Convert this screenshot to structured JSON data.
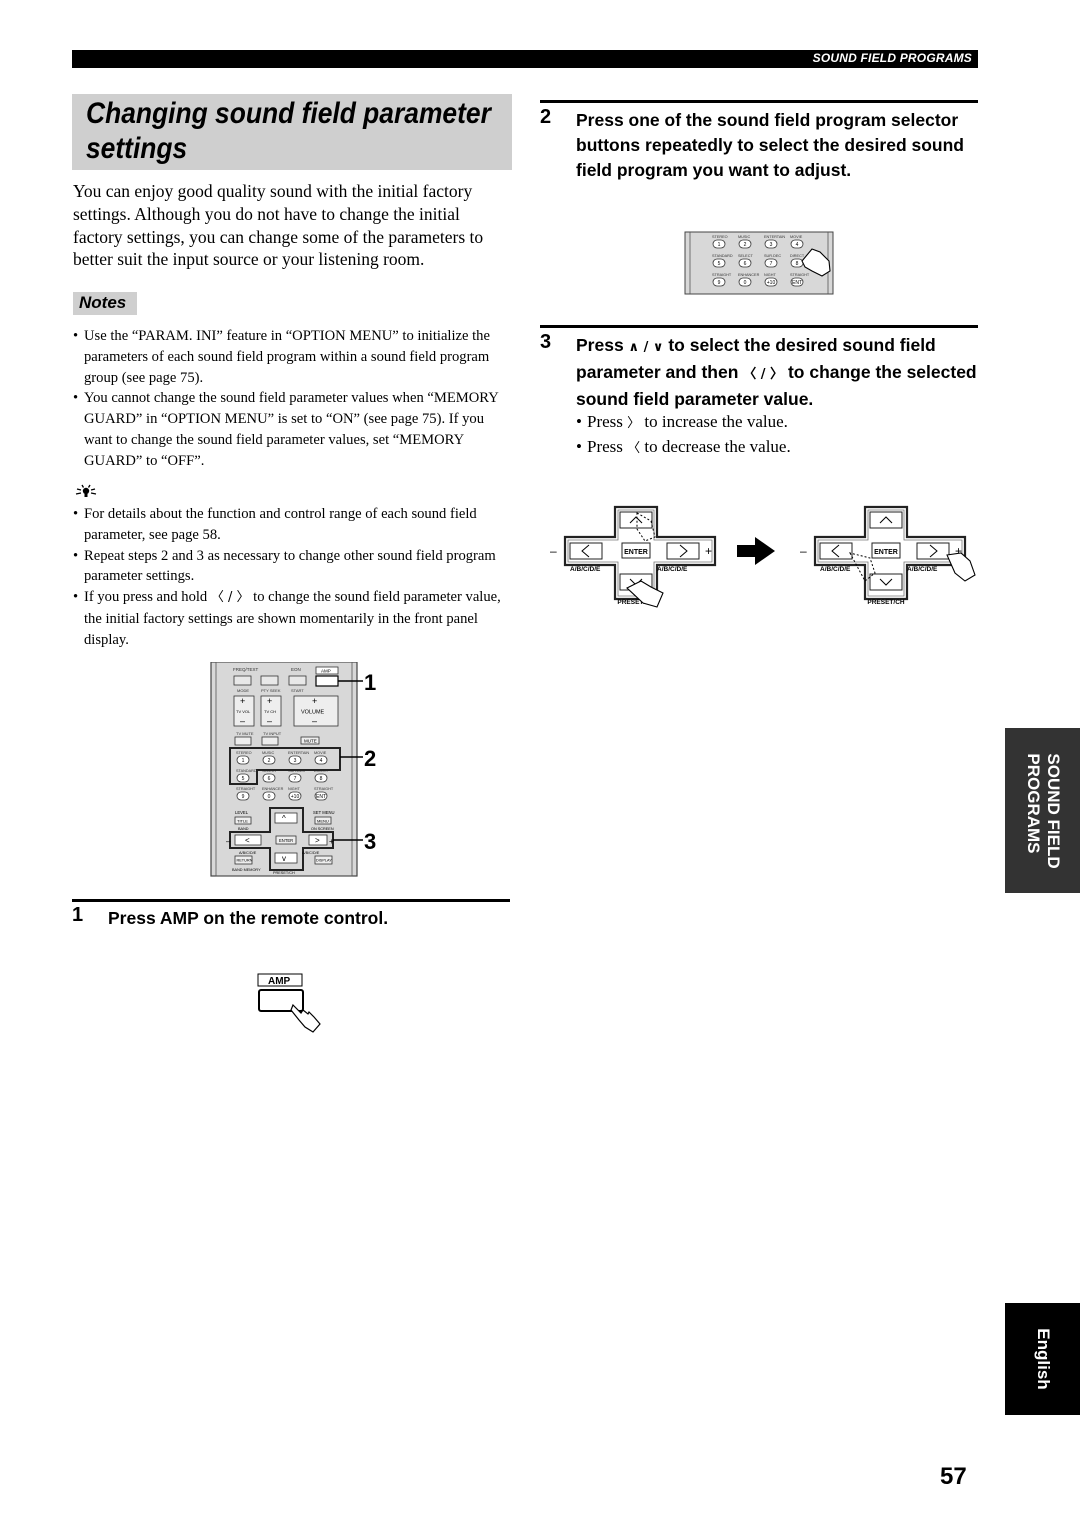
{
  "header": {
    "section_label": "SOUND FIELD PROGRAMS"
  },
  "title": {
    "line1": "Changing sound field parameter",
    "line2": "settings"
  },
  "intro": "You can enjoy good quality sound with the initial factory settings. Although you do not have to change the initial factory settings, you can change some of the parameters to better suit the input source or your listening room.",
  "notes": {
    "heading": "Notes",
    "items": [
      "Use the “PARAM. INI” feature in “OPTION MENU” to initialize the parameters of each sound field program within a sound field program group (see page 75).",
      "You cannot change the sound field parameter values when “MEMORY GUARD” in “OPTION MENU” is set to “ON” (see page 75). If you want to change the sound field parameter values, set “MEMORY GUARD” to “OFF”."
    ]
  },
  "tips": {
    "icon": "lightbulb-tip-icon",
    "items": [
      "For details about the function and control range of each sound field parameter, see page 58.",
      "Repeat steps 2 and 3 as necessary to change other sound field program parameter settings.",
      {
        "before": "If you press and hold ",
        "glyphs": "〈 / 〉",
        "after": " to change the sound field parameter value, the initial factory settings are shown momentarily in the front panel display."
      }
    ]
  },
  "remote": {
    "callouts": [
      "1",
      "2",
      "3"
    ],
    "top_labels": [
      "FREQ/TEXT",
      "EON",
      "AMP"
    ],
    "sub_labels": [
      "MODE",
      "PTY SEEK",
      "START"
    ],
    "vol_labels": [
      "TV VOL",
      "TV CH",
      "VOLUME"
    ],
    "mute_labels": [
      "TV MUTE",
      "TV INPUT",
      "MUTE"
    ],
    "program_rows": [
      {
        "labels": [
          "STEREO",
          "MUSIC",
          "ENTERTAIN",
          "MOVIE"
        ],
        "keys": [
          "1",
          "2",
          "3",
          "4"
        ]
      },
      {
        "labels": [
          "STANDARD",
          "SELECT",
          "SUR.DEC",
          "DIRECT"
        ],
        "keys": [
          "5",
          "6",
          "7",
          "8"
        ]
      },
      {
        "labels": [
          "STRAIGHT",
          "ENHANCER",
          "NIGHT",
          "STRAIGHT"
        ],
        "keys": [
          "9",
          "0",
          "+10",
          "ENT"
        ]
      }
    ],
    "nav_labels": {
      "level": "LEVEL",
      "title": "TITLE",
      "band": "BAND",
      "set_menu": "SET MENU",
      "menu": "MENU",
      "on_screen": "ON SCREEN",
      "enter": "ENTER",
      "abcde": "A/B/C/D/E",
      "return": "RETURN",
      "display": "DISPLAY",
      "memory": "BAND MEMORY",
      "preset": "PRESET/CH",
      "minus": "–",
      "plus": "+"
    }
  },
  "steps": [
    {
      "number": "1",
      "text": "Press AMP on the remote control.",
      "illustration_label": "AMP"
    },
    {
      "number": "2",
      "text": "Press one of the sound field program selector buttons repeatedly to select the desired sound field program you want to adjust."
    },
    {
      "number": "3",
      "text_parts": [
        "Press ",
        "∧ / ∨",
        " to select the desired sound field parameter and then ",
        "〈 / 〉",
        " to change the selected sound field parameter value."
      ],
      "bullets": [
        {
          "before": "Press ",
          "glyph": "〉",
          "after": " to increase the value."
        },
        {
          "before": "Press ",
          "glyph": "〈",
          "after": " to decrease the value."
        }
      ],
      "pad_labels": {
        "enter": "ENTER",
        "abcde": "A/B/C/D/E",
        "preset": "PRESET/CH",
        "minus": "–",
        "plus": "+"
      }
    }
  ],
  "side_tabs": {
    "section": [
      "SOUND FIELD",
      "PROGRAMS"
    ],
    "language": "English"
  },
  "page_number": "57"
}
